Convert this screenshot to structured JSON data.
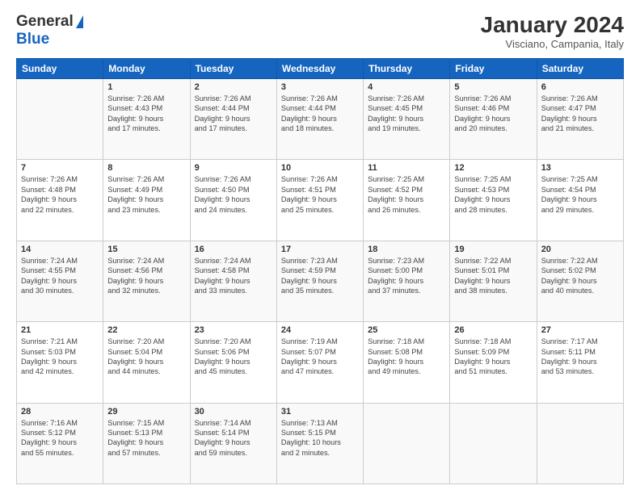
{
  "header": {
    "logo_general": "General",
    "logo_blue": "Blue",
    "title": "January 2024",
    "subtitle": "Visciano, Campania, Italy"
  },
  "days_of_week": [
    "Sunday",
    "Monday",
    "Tuesday",
    "Wednesday",
    "Thursday",
    "Friday",
    "Saturday"
  ],
  "weeks": [
    [
      {
        "day": "",
        "data": ""
      },
      {
        "day": "1",
        "data": "Sunrise: 7:26 AM\nSunset: 4:43 PM\nDaylight: 9 hours\nand 17 minutes."
      },
      {
        "day": "2",
        "data": "Sunrise: 7:26 AM\nSunset: 4:44 PM\nDaylight: 9 hours\nand 17 minutes."
      },
      {
        "day": "3",
        "data": "Sunrise: 7:26 AM\nSunset: 4:44 PM\nDaylight: 9 hours\nand 18 minutes."
      },
      {
        "day": "4",
        "data": "Sunrise: 7:26 AM\nSunset: 4:45 PM\nDaylight: 9 hours\nand 19 minutes."
      },
      {
        "day": "5",
        "data": "Sunrise: 7:26 AM\nSunset: 4:46 PM\nDaylight: 9 hours\nand 20 minutes."
      },
      {
        "day": "6",
        "data": "Sunrise: 7:26 AM\nSunset: 4:47 PM\nDaylight: 9 hours\nand 21 minutes."
      }
    ],
    [
      {
        "day": "7",
        "data": "Sunrise: 7:26 AM\nSunset: 4:48 PM\nDaylight: 9 hours\nand 22 minutes."
      },
      {
        "day": "8",
        "data": "Sunrise: 7:26 AM\nSunset: 4:49 PM\nDaylight: 9 hours\nand 23 minutes."
      },
      {
        "day": "9",
        "data": "Sunrise: 7:26 AM\nSunset: 4:50 PM\nDaylight: 9 hours\nand 24 minutes."
      },
      {
        "day": "10",
        "data": "Sunrise: 7:26 AM\nSunset: 4:51 PM\nDaylight: 9 hours\nand 25 minutes."
      },
      {
        "day": "11",
        "data": "Sunrise: 7:25 AM\nSunset: 4:52 PM\nDaylight: 9 hours\nand 26 minutes."
      },
      {
        "day": "12",
        "data": "Sunrise: 7:25 AM\nSunset: 4:53 PM\nDaylight: 9 hours\nand 28 minutes."
      },
      {
        "day": "13",
        "data": "Sunrise: 7:25 AM\nSunset: 4:54 PM\nDaylight: 9 hours\nand 29 minutes."
      }
    ],
    [
      {
        "day": "14",
        "data": "Sunrise: 7:24 AM\nSunset: 4:55 PM\nDaylight: 9 hours\nand 30 minutes."
      },
      {
        "day": "15",
        "data": "Sunrise: 7:24 AM\nSunset: 4:56 PM\nDaylight: 9 hours\nand 32 minutes."
      },
      {
        "day": "16",
        "data": "Sunrise: 7:24 AM\nSunset: 4:58 PM\nDaylight: 9 hours\nand 33 minutes."
      },
      {
        "day": "17",
        "data": "Sunrise: 7:23 AM\nSunset: 4:59 PM\nDaylight: 9 hours\nand 35 minutes."
      },
      {
        "day": "18",
        "data": "Sunrise: 7:23 AM\nSunset: 5:00 PM\nDaylight: 9 hours\nand 37 minutes."
      },
      {
        "day": "19",
        "data": "Sunrise: 7:22 AM\nSunset: 5:01 PM\nDaylight: 9 hours\nand 38 minutes."
      },
      {
        "day": "20",
        "data": "Sunrise: 7:22 AM\nSunset: 5:02 PM\nDaylight: 9 hours\nand 40 minutes."
      }
    ],
    [
      {
        "day": "21",
        "data": "Sunrise: 7:21 AM\nSunset: 5:03 PM\nDaylight: 9 hours\nand 42 minutes."
      },
      {
        "day": "22",
        "data": "Sunrise: 7:20 AM\nSunset: 5:04 PM\nDaylight: 9 hours\nand 44 minutes."
      },
      {
        "day": "23",
        "data": "Sunrise: 7:20 AM\nSunset: 5:06 PM\nDaylight: 9 hours\nand 45 minutes."
      },
      {
        "day": "24",
        "data": "Sunrise: 7:19 AM\nSunset: 5:07 PM\nDaylight: 9 hours\nand 47 minutes."
      },
      {
        "day": "25",
        "data": "Sunrise: 7:18 AM\nSunset: 5:08 PM\nDaylight: 9 hours\nand 49 minutes."
      },
      {
        "day": "26",
        "data": "Sunrise: 7:18 AM\nSunset: 5:09 PM\nDaylight: 9 hours\nand 51 minutes."
      },
      {
        "day": "27",
        "data": "Sunrise: 7:17 AM\nSunset: 5:11 PM\nDaylight: 9 hours\nand 53 minutes."
      }
    ],
    [
      {
        "day": "28",
        "data": "Sunrise: 7:16 AM\nSunset: 5:12 PM\nDaylight: 9 hours\nand 55 minutes."
      },
      {
        "day": "29",
        "data": "Sunrise: 7:15 AM\nSunset: 5:13 PM\nDaylight: 9 hours\nand 57 minutes."
      },
      {
        "day": "30",
        "data": "Sunrise: 7:14 AM\nSunset: 5:14 PM\nDaylight: 9 hours\nand 59 minutes."
      },
      {
        "day": "31",
        "data": "Sunrise: 7:13 AM\nSunset: 5:15 PM\nDaylight: 10 hours\nand 2 minutes."
      },
      {
        "day": "",
        "data": ""
      },
      {
        "day": "",
        "data": ""
      },
      {
        "day": "",
        "data": ""
      }
    ]
  ]
}
